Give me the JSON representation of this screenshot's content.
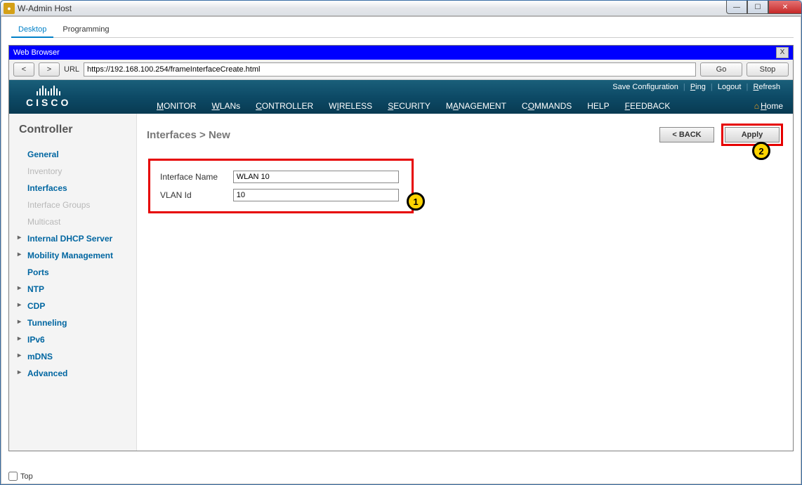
{
  "window": {
    "title": "W-Admin Host"
  },
  "appTabs": {
    "desktop": "Desktop",
    "programming": "Programming"
  },
  "browser": {
    "title": "Web Browser",
    "urlLabel": "URL",
    "url": "https://192.168.100.254/frameInterfaceCreate.html",
    "go": "Go",
    "stop": "Stop",
    "back": "<",
    "fwd": ">"
  },
  "utility": {
    "save": "Save Configuration",
    "ping": "Ping",
    "logout": "Logout",
    "refresh": "Refresh"
  },
  "brand": "CISCO",
  "nav": {
    "monitor": "MONITOR",
    "wlans": "WLANs",
    "controller": "CONTROLLER",
    "wireless": "WIRELESS",
    "security": "SECURITY",
    "management": "MANAGEMENT",
    "commands": "COMMANDS",
    "help": "HELP",
    "feedback": "FEEDBACK",
    "home": "Home"
  },
  "sidebar": {
    "title": "Controller",
    "items": {
      "general": "General",
      "inventory": "Inventory",
      "interfaces": "Interfaces",
      "ifgroups": "Interface Groups",
      "multicast": "Multicast",
      "dhcp": "Internal DHCP Server",
      "mobility": "Mobility Management",
      "ports": "Ports",
      "ntp": "NTP",
      "cdp": "CDP",
      "tunneling": "Tunneling",
      "ipv6": "IPv6",
      "mdns": "mDNS",
      "advanced": "Advanced"
    }
  },
  "page": {
    "title": "Interfaces > New",
    "backBtn": "< BACK",
    "applyBtn": "Apply"
  },
  "form": {
    "ifNameLabel": "Interface Name",
    "ifNameValue": "WLAN 10",
    "vlanLabel": "VLAN Id",
    "vlanValue": "10"
  },
  "callouts": {
    "one": "1",
    "two": "2"
  },
  "footer": {
    "top": "Top"
  }
}
